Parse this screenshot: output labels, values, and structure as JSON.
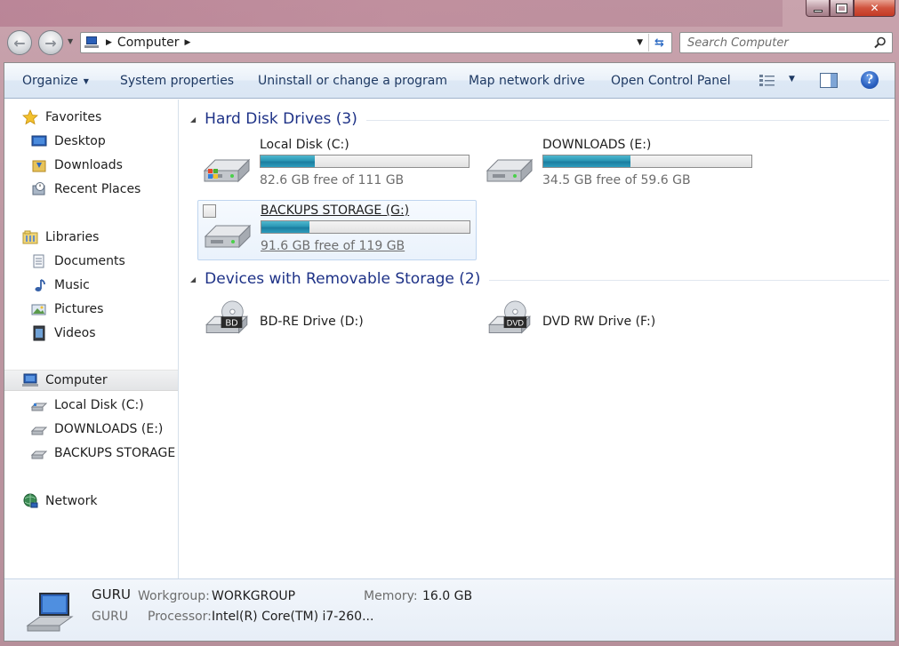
{
  "window": {
    "address": "Computer",
    "search_placeholder": "Search Computer"
  },
  "toolbar": {
    "organize": "Organize",
    "system_properties": "System properties",
    "uninstall": "Uninstall or change a program",
    "map_drive": "Map network drive",
    "control_panel": "Open Control Panel"
  },
  "sidebar": {
    "favorites": "Favorites",
    "desktop": "Desktop",
    "downloads": "Downloads",
    "recent_places": "Recent Places",
    "libraries": "Libraries",
    "documents": "Documents",
    "music": "Music",
    "pictures": "Pictures",
    "videos": "Videos",
    "computer": "Computer",
    "local_disk": "Local Disk (C:)",
    "downloads_drive": "DOWNLOADS (E:)",
    "backups_drive": "BACKUPS STORAGE (G:)",
    "network": "Network"
  },
  "groups": {
    "hard_disks": "Hard Disk Drives (3)",
    "removable": "Devices with Removable Storage (2)"
  },
  "drives": [
    {
      "name": "Local Disk (C:)",
      "free": "82.6 GB free of 111 GB",
      "used_fraction": 0.26
    },
    {
      "name": "DOWNLOADS (E:)",
      "free": "34.5 GB free of 59.6 GB",
      "used_fraction": 0.42
    },
    {
      "name": "BACKUPS STORAGE (G:)",
      "free": "91.6 GB free of 119 GB",
      "used_fraction": 0.23
    }
  ],
  "removable": [
    {
      "name": "BD-RE Drive (D:)",
      "badge": "BD"
    },
    {
      "name": "DVD RW Drive (F:)",
      "badge": "DVD"
    }
  ],
  "details": {
    "computer_name": "GURU",
    "computer_name2": "GURU",
    "workgroup_label": "Workgroup:",
    "workgroup": "WORKGROUP",
    "memory_label": "Memory:",
    "memory": "16.0 GB",
    "processor_label": "Processor:",
    "processor": "Intel(R) Core(TM) i7-260..."
  },
  "colors": {
    "group_title": "#1e3287",
    "command_text": "#1e3963",
    "bar_fill": "#2a97b5"
  }
}
